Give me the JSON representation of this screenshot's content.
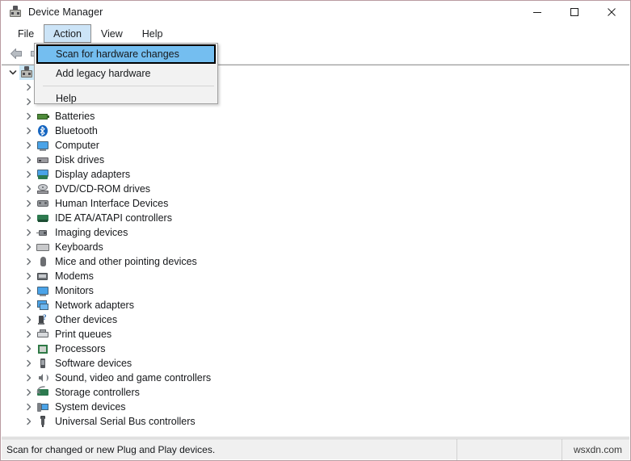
{
  "window": {
    "title": "Device Manager",
    "title_icon": "device-manager-icon",
    "minimize_label": "–",
    "maximize_label": "□",
    "close_label": "✕"
  },
  "menubar": {
    "items": [
      {
        "label": "File",
        "open": false
      },
      {
        "label": "Action",
        "open": true
      },
      {
        "label": "View",
        "open": false
      },
      {
        "label": "Help",
        "open": false
      }
    ]
  },
  "toolbar": {
    "buttons": [
      {
        "name": "back-icon"
      },
      {
        "name": "forward-icon"
      }
    ]
  },
  "dropdown": {
    "owner": "Action",
    "items": [
      {
        "label": "Scan for hardware changes",
        "highlighted": true,
        "separator_after": false
      },
      {
        "label": "Add legacy hardware",
        "highlighted": false,
        "separator_after": true
      },
      {
        "label": "Help",
        "highlighted": false,
        "separator_after": false
      }
    ]
  },
  "tree": {
    "root": {
      "label": "",
      "icon": "computer-icon",
      "expanded": true,
      "selected": true
    },
    "items": [
      {
        "label": "",
        "icon": "none",
        "hidden": true
      },
      {
        "label": "",
        "icon": "none",
        "hidden": true
      },
      {
        "label": "Batteries",
        "icon": "battery-icon"
      },
      {
        "label": "Bluetooth",
        "icon": "bluetooth-icon"
      },
      {
        "label": "Computer",
        "icon": "monitor-icon"
      },
      {
        "label": "Disk drives",
        "icon": "disk-drive-icon"
      },
      {
        "label": "Display adapters",
        "icon": "display-adapter-icon"
      },
      {
        "label": "DVD/CD-ROM drives",
        "icon": "disc-drive-icon"
      },
      {
        "label": "Human Interface Devices",
        "icon": "hid-icon"
      },
      {
        "label": "IDE ATA/ATAPI controllers",
        "icon": "ide-controller-icon"
      },
      {
        "label": "Imaging devices",
        "icon": "imaging-device-icon"
      },
      {
        "label": "Keyboards",
        "icon": "keyboard-icon"
      },
      {
        "label": "Mice and other pointing devices",
        "icon": "mouse-icon"
      },
      {
        "label": "Modems",
        "icon": "modem-icon"
      },
      {
        "label": "Monitors",
        "icon": "monitor-icon"
      },
      {
        "label": "Network adapters",
        "icon": "network-adapter-icon"
      },
      {
        "label": "Other devices",
        "icon": "other-device-icon"
      },
      {
        "label": "Print queues",
        "icon": "printer-icon"
      },
      {
        "label": "Processors",
        "icon": "processor-icon"
      },
      {
        "label": "Software devices",
        "icon": "software-device-icon"
      },
      {
        "label": "Sound, video and game controllers",
        "icon": "sound-icon"
      },
      {
        "label": "Storage controllers",
        "icon": "storage-controller-icon"
      },
      {
        "label": "System devices",
        "icon": "system-device-icon"
      },
      {
        "label": "Universal Serial Bus controllers",
        "icon": "usb-icon"
      }
    ]
  },
  "statusbar": {
    "message": "Scan for changed or new Plug and Play devices.",
    "middle": "",
    "watermark": "wsxdn.com"
  },
  "colors": {
    "menu_highlight": "#74bef0",
    "menu_open_bg": "#cce4f7",
    "window_border": "#b99ba1",
    "status_bg": "#f0f0f0"
  }
}
